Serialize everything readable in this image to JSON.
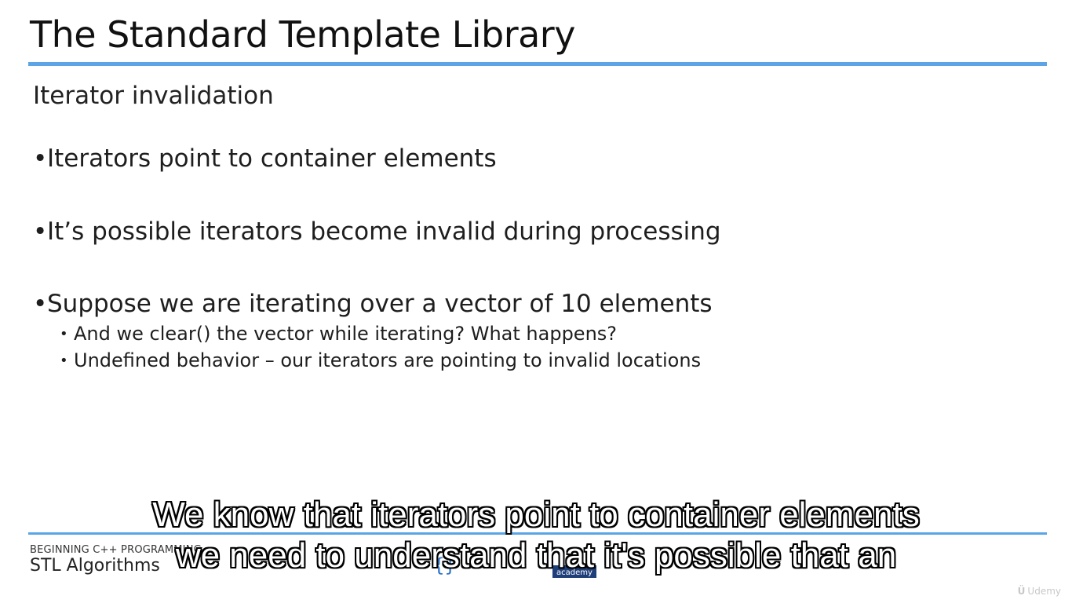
{
  "slide": {
    "title": "The Standard Template Library",
    "subtitle": "Iterator invalidation",
    "bullets": [
      "Iterators point to container elements",
      "It’s possible iterators become invalid during processing",
      "Suppose we are iterating over a vector of 10 elements"
    ],
    "sub_bullets": [
      "And we clear() the vector while iterating? What happens?",
      "Undefined behavior – our iterators are pointing to invalid locations"
    ],
    "bullet_glyph": "•"
  },
  "footer": {
    "course": "BEGINNING C++ PROGRAMMING",
    "section": "STL Algorithms",
    "logo_text": "academy"
  },
  "watermark": {
    "brand": "Udemy",
    "glyph": "Ü"
  },
  "captions": {
    "line1": "We know that iterators point to container elements",
    "line2": "we need to understand that it's possible that an"
  },
  "colors": {
    "accent_rule": "#5ba5e6",
    "logo_blue": "#2f73c8",
    "logo_dark": "#1f3f7a"
  }
}
